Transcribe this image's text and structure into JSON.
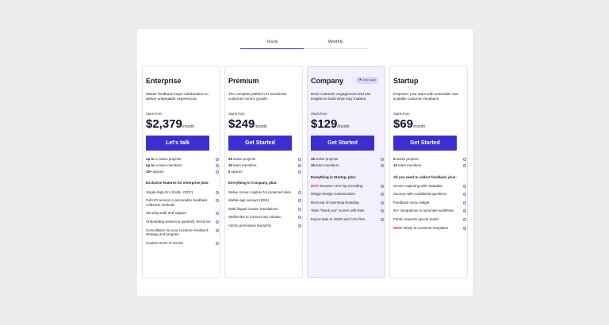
{
  "toggle": {
    "yearly": "Yearly",
    "monthly": "Monthly"
  },
  "plans": [
    {
      "name": "Enterprise",
      "description": "Master feedback loops collaboration to deliver unbeatable experiences.",
      "starts": "Starts from",
      "price": "$2,379",
      "per": "/month",
      "cta": "Let's talk",
      "limits": [
        {
          "bold": "up to ∞",
          "text": " active projects"
        },
        {
          "bold": "up to ∞",
          "text": " team members"
        },
        {
          "bold": "10+",
          "text": " spaces"
        }
      ],
      "section": "Exclusive features for enterprise plan:",
      "features": [
        {
          "tag": "",
          "text": "Single-Sign-On (SAML, OIDC)"
        },
        {
          "tag": "",
          "text": "Full API access to personalize feedback collection methods"
        },
        {
          "tag": "",
          "text": "Security audit and support"
        },
        {
          "tag": "",
          "text": "Onboarding session & quarterly check-ins"
        },
        {
          "tag": "",
          "text": "Consultation for your customer feedback strategy and program"
        },
        {
          "tag": "",
          "text": "Custom terms of service"
        }
      ]
    },
    {
      "name": "Premium",
      "description": "The complete platform to accelerate customer-centric growth.",
      "starts": "Starts from",
      "price": "$249",
      "per": "/month",
      "cta": "Get Started",
      "limits": [
        {
          "bold": "25",
          "text": " active projects"
        },
        {
          "bold": "25",
          "text": " team members"
        },
        {
          "bold": "5",
          "text": " spaces"
        }
      ],
      "section": "Everything in Company, plus:",
      "features": [
        {
          "tag": "",
          "text": "Native screen capture for protected sites"
        },
        {
          "tag": "",
          "text": "Mobile app surveys (SDK)"
        },
        {
          "tag": "",
          "text": "Multi-lingual custom translations"
        },
        {
          "tag": "",
          "text": "Webhooks to connect any solution"
        },
        {
          "tag": "",
          "text": "Admin permission hierarchy"
        }
      ]
    },
    {
      "name": "Company",
      "badge": "Best value",
      "description": "Drive customer engagement and use insights to build what truly matters.",
      "starts": "Starts from",
      "price": "$129",
      "per": "/month",
      "cta": "Get Started",
      "limits": [
        {
          "bold": "15",
          "text": " active projects"
        },
        {
          "bold": "15",
          "text": " team members"
        }
      ],
      "section": "Everything in Startup, plus:",
      "features": [
        {
          "tag": "HOT!",
          "text": " Browser error log recording"
        },
        {
          "tag": "",
          "text": "Widget design customization"
        },
        {
          "tag": "",
          "text": "Removal of Usersnap branding"
        },
        {
          "tag": "",
          "text": "Tailor \"thank you\" screen with links"
        },
        {
          "tag": "",
          "text": "Export data to JSON and CSV files"
        }
      ]
    },
    {
      "name": "Startup",
      "description": "Empower your team with actionable and scalable customer feedback.",
      "starts": "Starts from",
      "price": "$69",
      "per": "/month",
      "cta": "Get Started",
      "limits": [
        {
          "bold": "5",
          "text": " active projects"
        },
        {
          "bold": "10",
          "text": " team members"
        }
      ],
      "section": "All you need to collect feedback, plus:",
      "features": [
        {
          "tag": "",
          "text": "Screen capturing with metadata"
        },
        {
          "tag": "",
          "text": "Surveys with conditional questions"
        },
        {
          "tag": "",
          "text": "Feedback menu widget"
        },
        {
          "tag": "",
          "text": "50+ integrations to automate workflows"
        },
        {
          "tag": "",
          "text": "Public requests upvote board"
        },
        {
          "tag": "NEW!",
          "text": " Reply-to-customer templates"
        }
      ]
    }
  ],
  "colors": {
    "accent": "#3b2fd0",
    "highlight_bg": "#f2f0fd",
    "tag": "#e0245e"
  }
}
